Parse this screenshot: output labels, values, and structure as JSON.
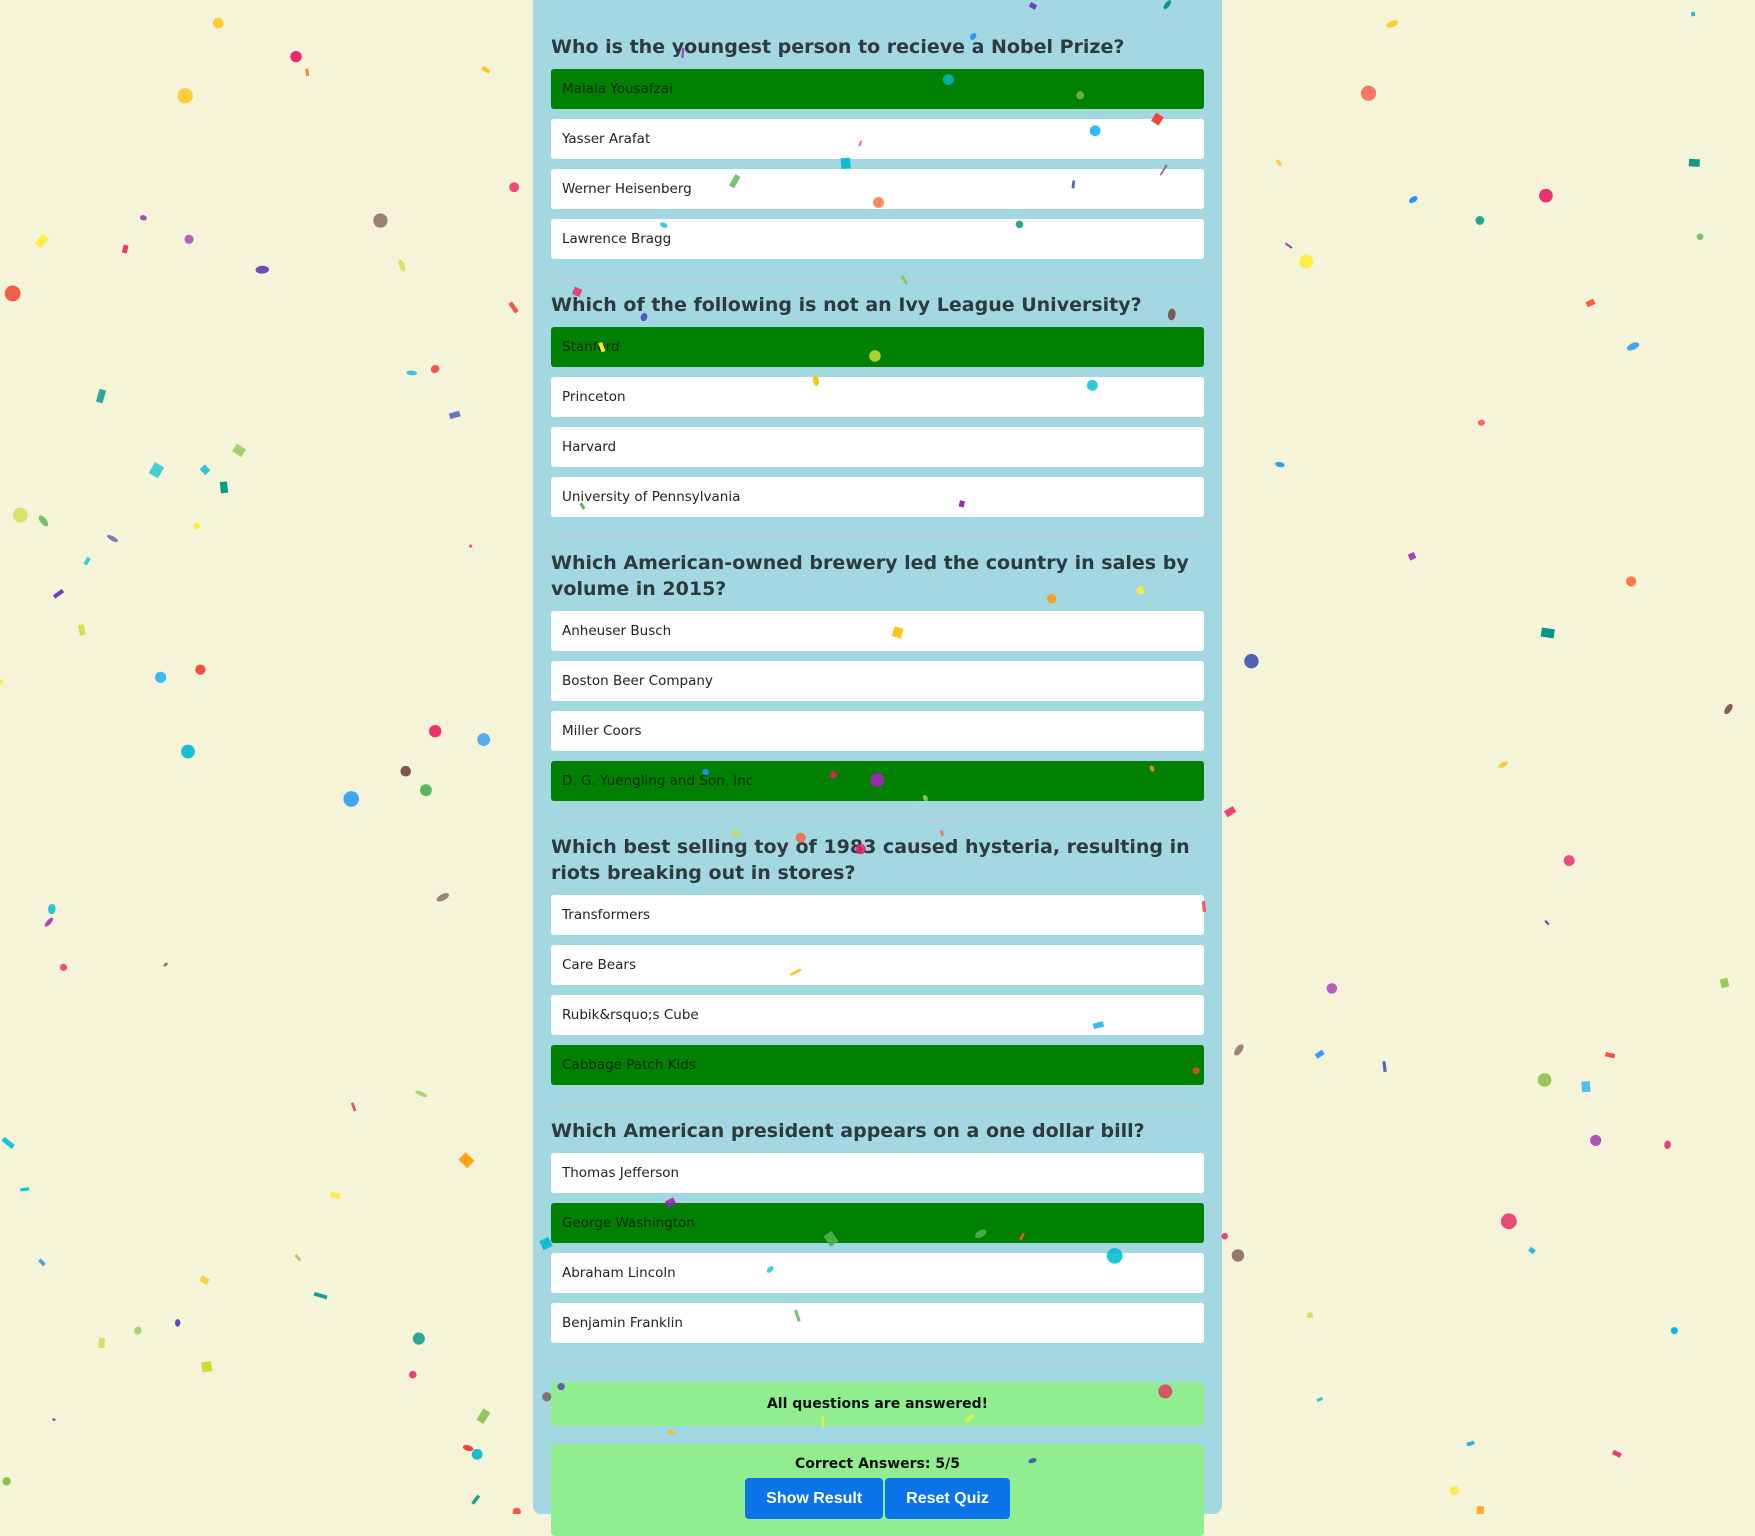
{
  "questions": [
    {
      "text": "Who is the youngest person to recieve a Nobel Prize?",
      "options": [
        {
          "label": "Malala Yousafzai",
          "correct": true
        },
        {
          "label": "Yasser Arafat",
          "correct": false
        },
        {
          "label": "Werner Heisenberg",
          "correct": false
        },
        {
          "label": "Lawrence Bragg",
          "correct": false
        }
      ]
    },
    {
      "text": "Which of the following is not an Ivy League University?",
      "options": [
        {
          "label": "Stanford",
          "correct": true
        },
        {
          "label": "Princeton",
          "correct": false
        },
        {
          "label": "Harvard",
          "correct": false
        },
        {
          "label": "University of Pennsylvania",
          "correct": false
        }
      ]
    },
    {
      "text": "Which American-owned brewery led the country in sales by volume in 2015?",
      "options": [
        {
          "label": "Anheuser Busch",
          "correct": false
        },
        {
          "label": "Boston Beer Company",
          "correct": false
        },
        {
          "label": "Miller Coors",
          "correct": false
        },
        {
          "label": "D. G. Yuengling and Son, Inc",
          "correct": true
        }
      ]
    },
    {
      "text": "Which best selling toy of 1983 caused hysteria, resulting in riots breaking out in stores?",
      "options": [
        {
          "label": "Transformers",
          "correct": false
        },
        {
          "label": "Care Bears",
          "correct": false
        },
        {
          "label": "Rubik&rsquo;s Cube",
          "correct": false
        },
        {
          "label": "Cabbage Patch Kids",
          "correct": true
        }
      ]
    },
    {
      "text": "Which American president appears on a one dollar bill?",
      "options": [
        {
          "label": "Thomas Jefferson",
          "correct": false
        },
        {
          "label": "George Washington",
          "correct": true
        },
        {
          "label": "Abraham Lincoln",
          "correct": false
        },
        {
          "label": "Benjamin Franklin",
          "correct": false
        }
      ]
    }
  ],
  "status": {
    "all_answered": "All questions are answered!",
    "correct_answers": "Correct Answers: 5/5"
  },
  "buttons": {
    "show_result": "Show Result",
    "reset_quiz": "Reset Quiz"
  },
  "colors": {
    "page_background": "#f5f4d8",
    "panel_background": "#a3d8e2",
    "correct_option": "#008000",
    "status_background": "#90ee90",
    "button": "#0a74e8",
    "confetti": [
      "#f44336",
      "#e91e63",
      "#9c27b0",
      "#673ab7",
      "#3f51b5",
      "#2196f3",
      "#03a9f4",
      "#00bcd4",
      "#009688",
      "#4caf50",
      "#8bc34a",
      "#cddc39",
      "#ffeb3b",
      "#ffc107",
      "#ff9800",
      "#ff5722",
      "#795548"
    ]
  }
}
